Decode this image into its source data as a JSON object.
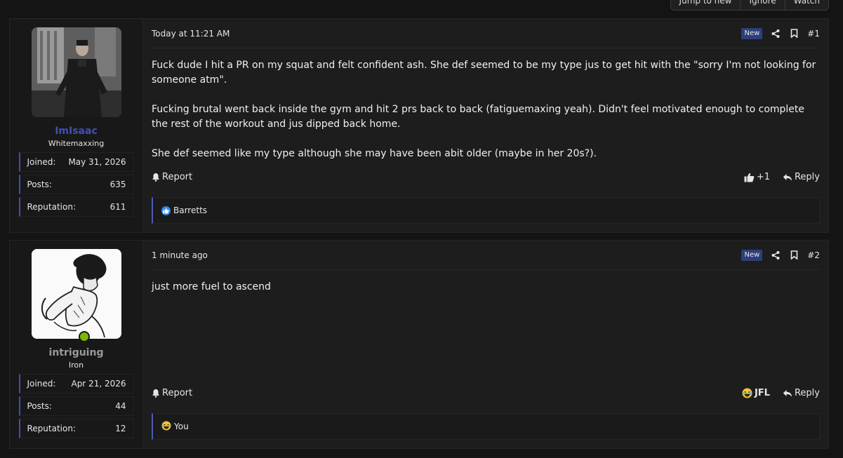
{
  "top_buttons": [
    "Jump to new",
    "Ignore",
    "Watch"
  ],
  "colors": {
    "accent": "#3f51b5",
    "online": "#7fb800",
    "new_badge": "#2d3f7b"
  },
  "posts": [
    {
      "user": {
        "name": "ImIsaac",
        "title": "Whitemaxxing",
        "stats": [
          {
            "label": "Joined:",
            "value": "May 31, 2026"
          },
          {
            "label": "Posts:",
            "value": "635"
          },
          {
            "label": "Reputation:",
            "value": "611"
          }
        ]
      },
      "date": "Today at 11:21 AM",
      "badge": "New",
      "number": "#1",
      "paragraphs": [
        "Fuck dude I hit a PR on my squat and felt confident ash. She def seemed to be my type jus to get hit with the \"sorry I'm not looking for someone atm\".",
        "Fucking brutal went back inside the gym and hit 2 prs back to back (fatiguemaxing yeah). Didn't feel motivated enough to complete the rest of the workout and jus dipped back home.",
        "She def seemed like my type although she may have been abit older (maybe in her 20s?)."
      ],
      "report_label": "Report",
      "reaction_label": "+1",
      "reply_label": "Reply",
      "reactions_by": "Barretts"
    },
    {
      "user": {
        "name": "intriguing",
        "title": "Iron",
        "stats": [
          {
            "label": "Joined:",
            "value": "Apr 21, 2026"
          },
          {
            "label": "Posts:",
            "value": "44"
          },
          {
            "label": "Reputation:",
            "value": "12"
          }
        ]
      },
      "date": "1 minute ago",
      "badge": "New",
      "number": "#2",
      "paragraphs": [
        "just more fuel to ascend"
      ],
      "report_label": "Report",
      "reaction_label": "JFL",
      "reply_label": "Reply",
      "reactions_by": "You"
    }
  ]
}
